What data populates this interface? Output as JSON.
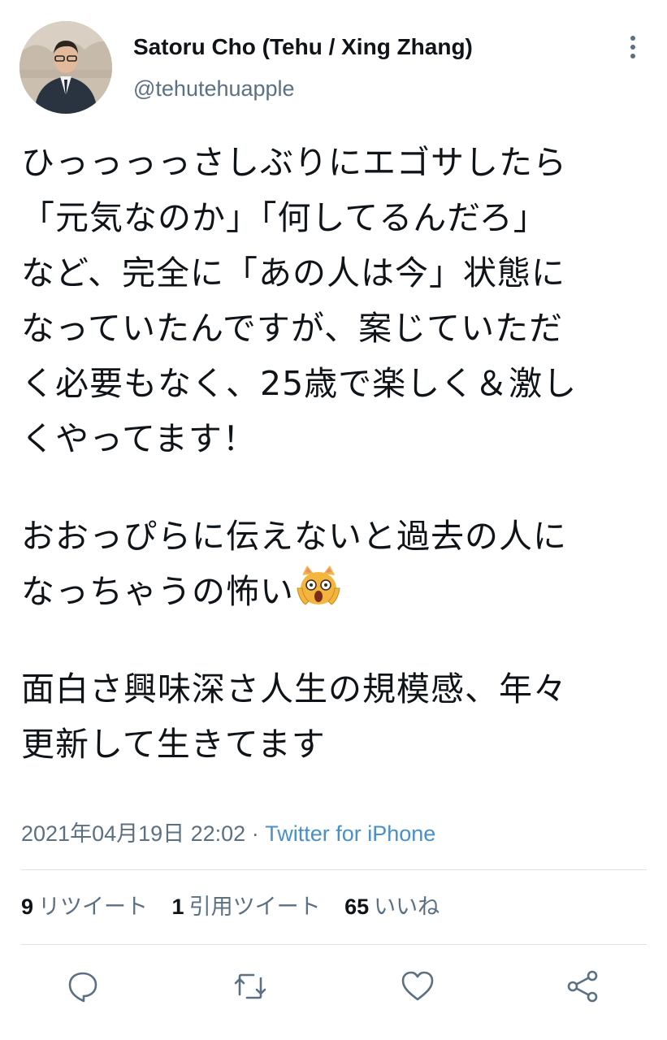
{
  "tweet": {
    "author": {
      "display_name": "Satoru Cho (Tehu / Xing Zhang)",
      "handle": "@tehutehuapple"
    },
    "text_lines": [
      "ひっっっっさしぶりにエゴサしたら",
      "「元気なのか」「何してるんだろ」",
      "など、完全に「あの人は今」状態に",
      "なっていたんですが、案じていただ",
      "く必要もなく、25歳で楽しく＆激し",
      "くやってます！",
      "",
      "おおっぴらに伝えないと過去の人に",
      "なっちゃうの怖い",
      "",
      "面白さ興味深さ人生の規模感、年々",
      "更新して生きてます"
    ],
    "emoji": "scream-cat",
    "timestamp": "2021年04月19日 22:02",
    "separator": " · ",
    "source": "Twitter for iPhone",
    "stats": {
      "retweets_count": "9",
      "retweets_label": "リツイート",
      "quotes_count": "1",
      "quotes_label": "引用ツイート",
      "likes_count": "65",
      "likes_label": "いいね"
    }
  },
  "icons": {
    "more": "more-vertical-icon",
    "reply": "reply-icon",
    "retweet": "retweet-icon",
    "like": "heart-icon",
    "share": "share-icon"
  },
  "colors": {
    "text": "#0f1419",
    "secondary": "#5b7083",
    "link": "#4a90c8",
    "divider": "#dde3e8",
    "icon": "#5b7083"
  }
}
